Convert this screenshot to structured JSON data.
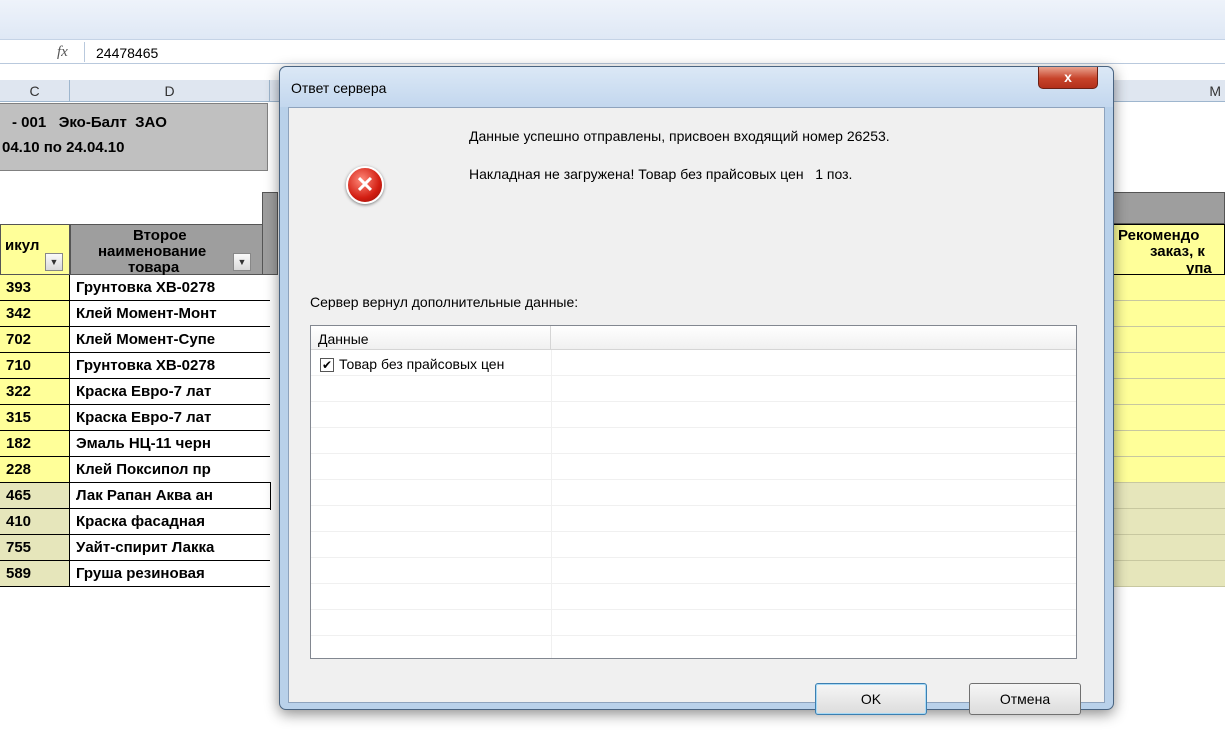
{
  "formula": {
    "fx_label": "fx",
    "value": "24478465"
  },
  "columns": {
    "c": "C",
    "d": "D",
    "m": "M"
  },
  "sheet": {
    "banner_line1": "- 001   Эко-Балт  ЗАО",
    "banner_line2": "04.10 по 24.04.10",
    "header_articul": "икул",
    "header_second_name_1": "Второе",
    "header_second_name_2": "наименование",
    "header_second_name_3": "товара",
    "header_right_1": "Рекомендо",
    "header_right_2": "заказ, к",
    "header_right_3": "упа",
    "rows": [
      {
        "code": "393",
        "name": "Грунтовка ХВ-0278"
      },
      {
        "code": "342",
        "name": "Клей Момент-Монт"
      },
      {
        "code": "702",
        "name": "Клей Момент-Супе"
      },
      {
        "code": "710",
        "name": "Грунтовка ХВ-0278"
      },
      {
        "code": "322",
        "name": "Краска Евро-7 лат"
      },
      {
        "code": "315",
        "name": "Краска Евро-7 лат"
      },
      {
        "code": "182",
        "name": "Эмаль НЦ-11 черн"
      },
      {
        "code": "228",
        "name": "Клей Поксипол пр"
      },
      {
        "code": "465",
        "name": "Лак Рапан Аква ан"
      },
      {
        "code": "410",
        "name": "Краска фасадная"
      },
      {
        "code": "755",
        "name": "Уайт-спирит Лакка"
      },
      {
        "code": "589",
        "name": "Груша резиновая"
      }
    ]
  },
  "dialog": {
    "title": "Ответ сервера",
    "close_label": "x",
    "message_1": "Данные успешно отправлены, присвоен входящий номер 26253.",
    "message_2": "Накладная не загружена! Товар без прайсовых цен   1 поз.",
    "extra_label": "Сервер вернул дополнительные данные:",
    "list_header": "Данные",
    "list_item": "Товар без прайсовых цен",
    "ok_label": "OK",
    "cancel_label": "Отмена"
  },
  "colors": {
    "row_code_bg": "#ffff99",
    "row_code_bg_alt": "#e6e6bb",
    "header_gray": "#9e9e9e",
    "dialog_frame": "#b9d1ea"
  }
}
